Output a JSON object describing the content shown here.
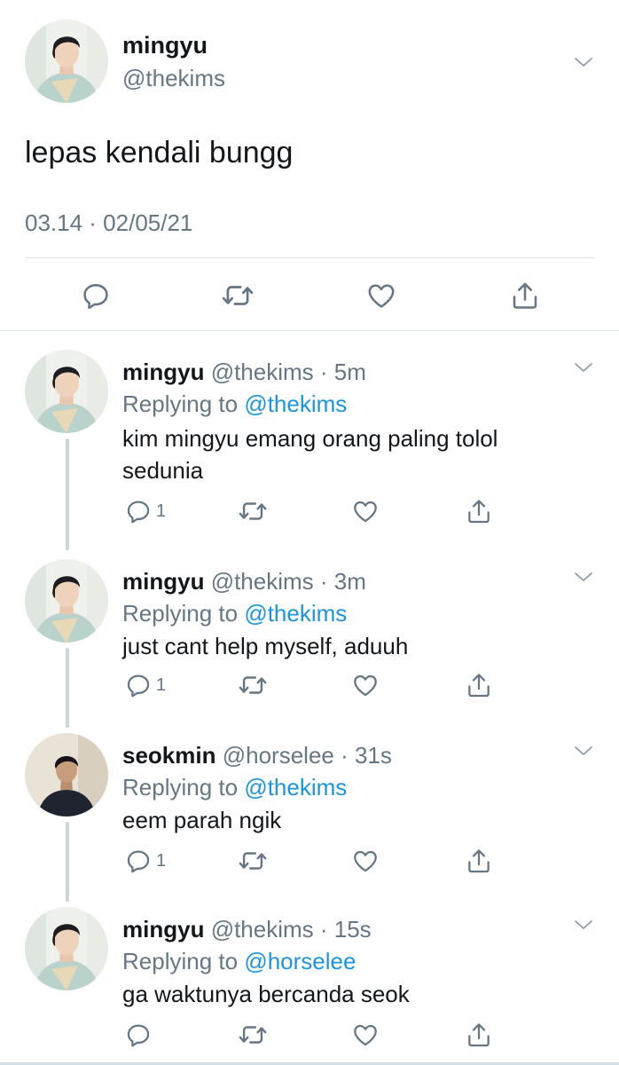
{
  "main_tweet": {
    "author": {
      "name": "mingyu",
      "handle": "@thekims"
    },
    "text": "lepas kendali bungg",
    "timestamp": "03.14 · 02/05/21",
    "icons": [
      "reply-icon",
      "retweet-icon",
      "like-icon",
      "share-icon",
      "chevron-down-icon"
    ]
  },
  "replies": [
    {
      "name": "mingyu",
      "handle_time": "@thekims · 5m",
      "replying_prefix": "Replying to ",
      "replying_to": "@thekims",
      "text_lines": [
        "kim mingyu emang orang paling tolol",
        "sedunia"
      ],
      "reply_count": "1"
    },
    {
      "name": "mingyu",
      "handle_time": "@thekims · 3m",
      "replying_prefix": "Replying to ",
      "replying_to": "@thekims",
      "text_lines": [
        "just cant help myself, aduuh"
      ],
      "reply_count": "1"
    },
    {
      "name": "seokmin",
      "handle_time": "@horselee · 31s",
      "replying_prefix": "Replying to ",
      "replying_to": "@thekims",
      "text_lines": [
        "eem parah ngik"
      ],
      "reply_count": "1"
    },
    {
      "name": "mingyu",
      "handle_time": "@thekims · 15s",
      "replying_prefix": "Replying to ",
      "replying_to": "@horselee",
      "text_lines": [
        "ga waktunya bercanda seok"
      ],
      "reply_count": ""
    }
  ],
  "colors": {
    "text": "#14171a",
    "secondary": "#657786",
    "link": "#1b95e0",
    "thread_line": "#ccd6dd",
    "divider": "#e1e8ed"
  }
}
